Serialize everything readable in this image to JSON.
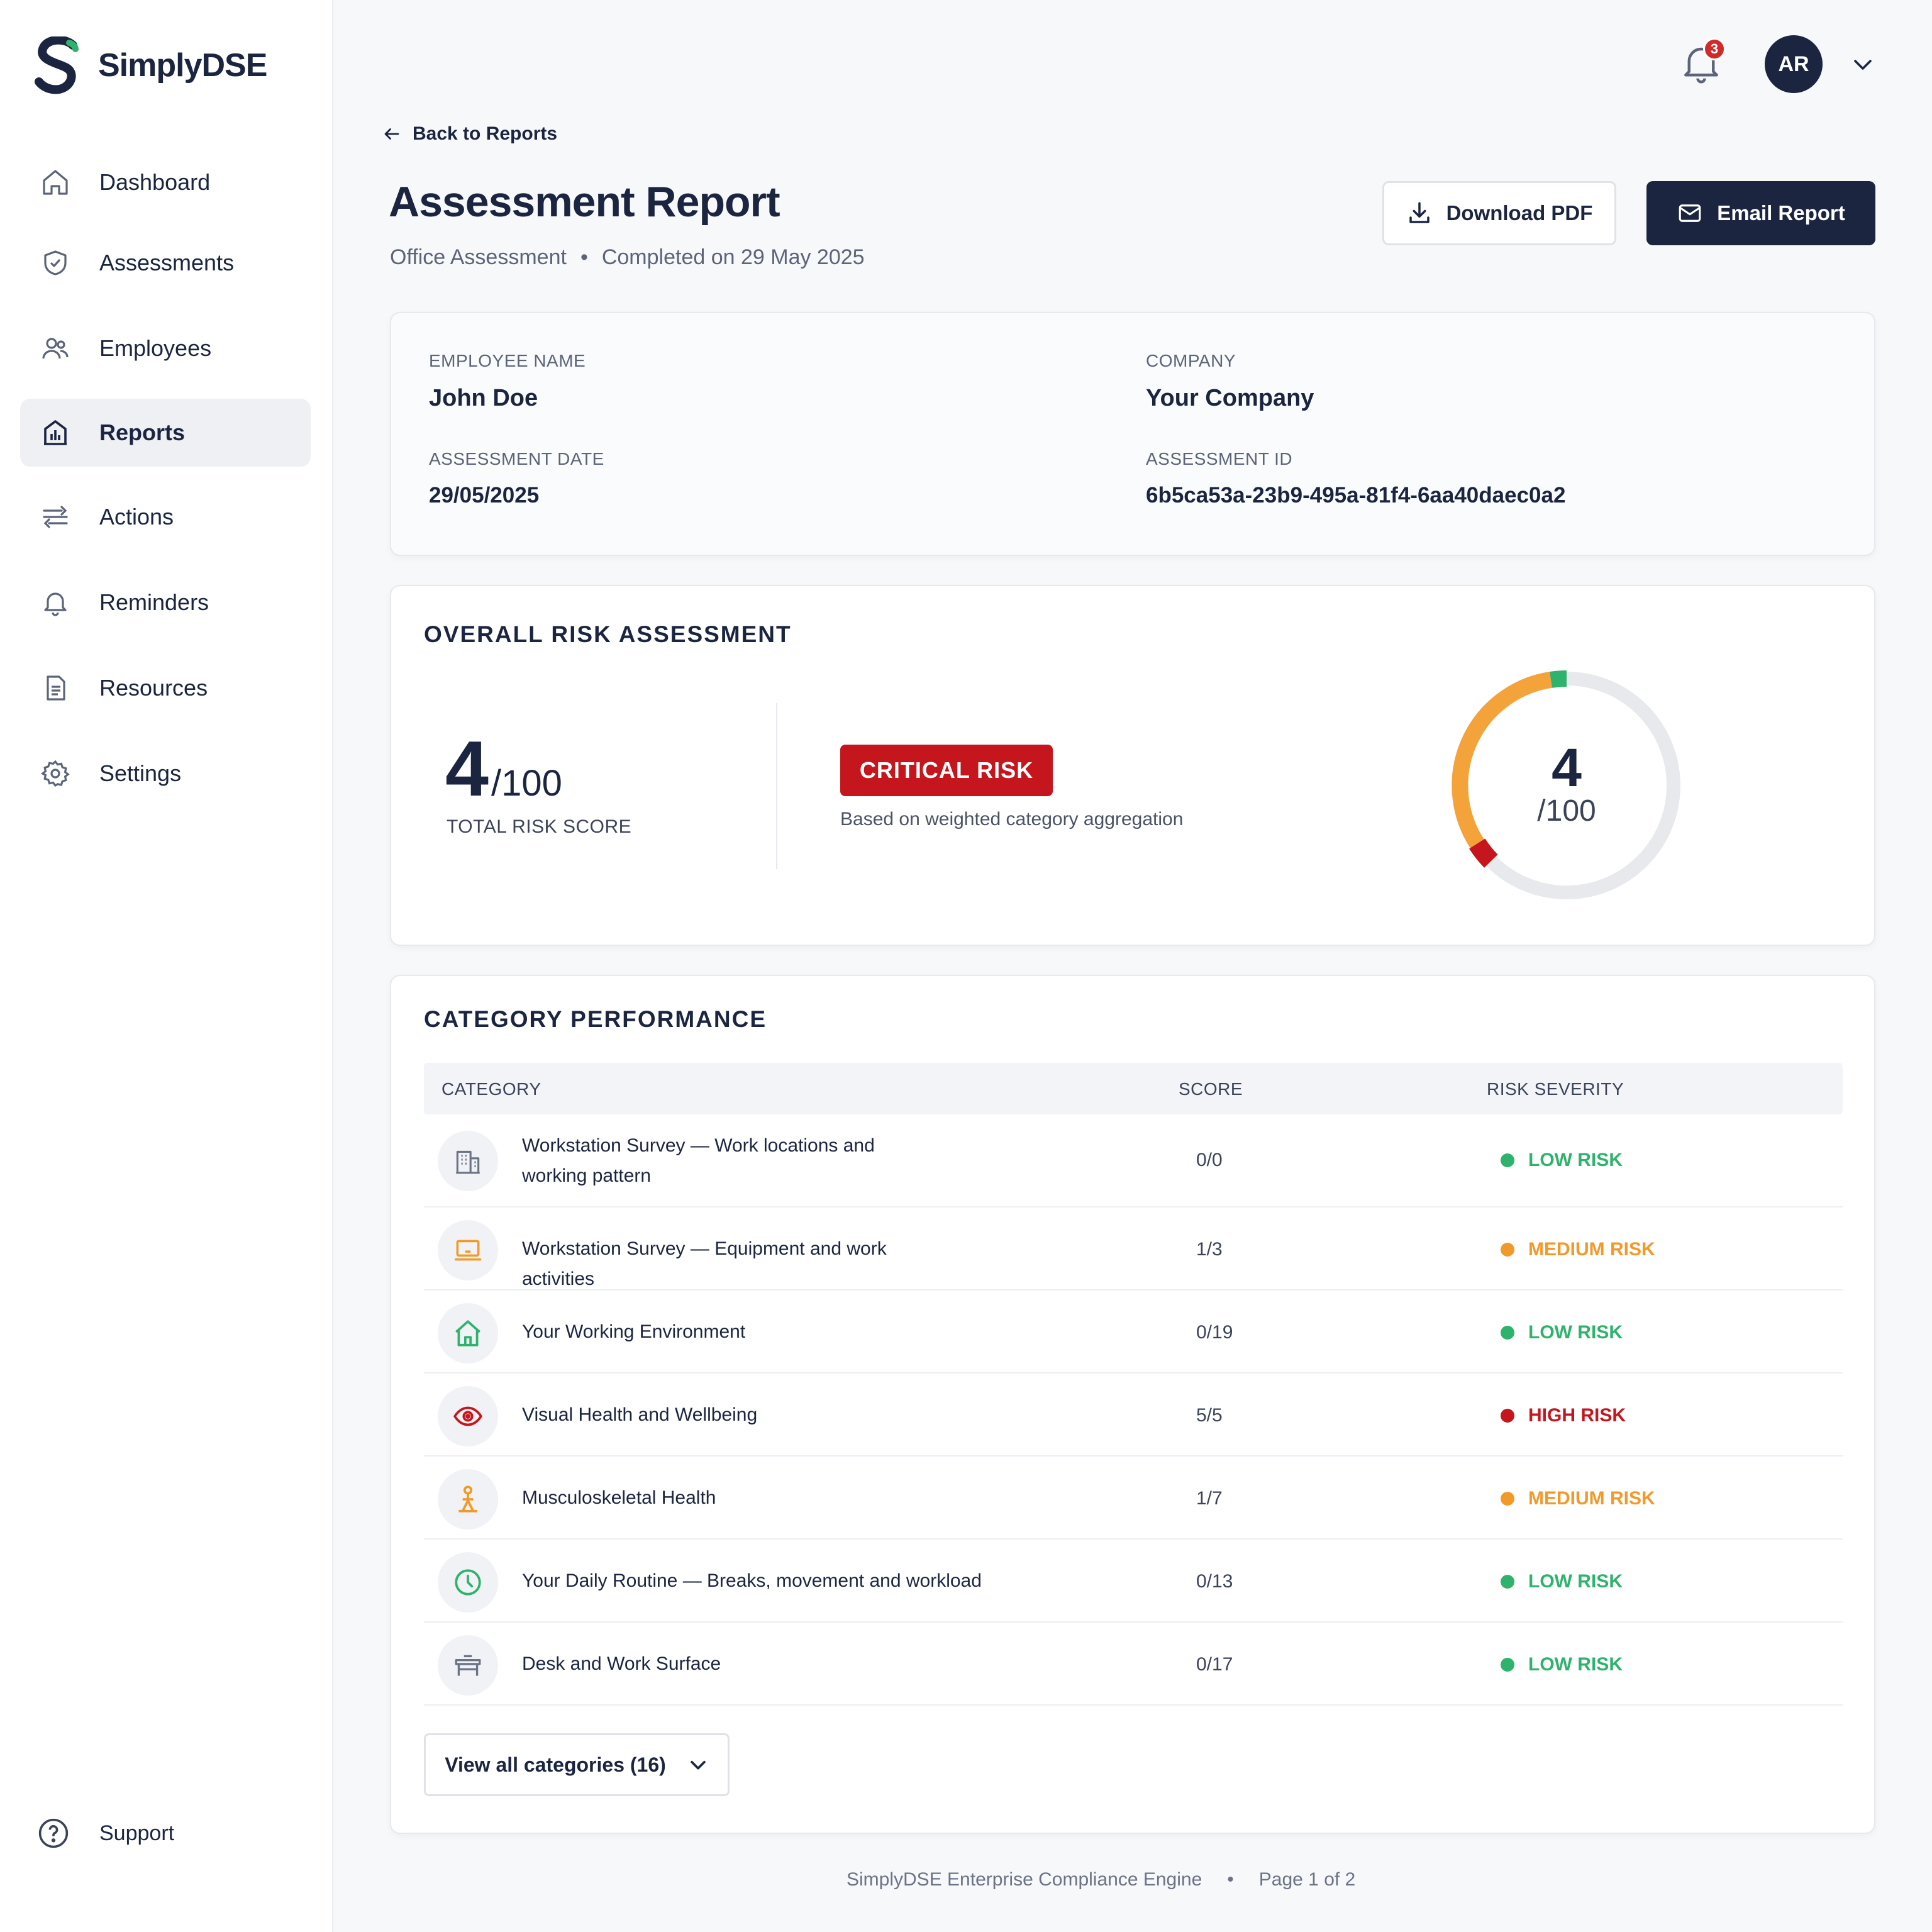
{
  "app": {
    "name": "SimplyDSE"
  },
  "sidebar": {
    "items": [
      {
        "label": "Dashboard",
        "icon": "home-icon",
        "active": false
      },
      {
        "label": "Assessments",
        "icon": "shield-check-icon",
        "active": false
      },
      {
        "label": "Employees",
        "icon": "users-icon",
        "active": false
      },
      {
        "label": "Reports",
        "icon": "bar-chart-icon",
        "active": true
      },
      {
        "label": "Actions",
        "icon": "sliders-icon",
        "active": false
      },
      {
        "label": "Reminders",
        "icon": "bell-icon",
        "active": false
      },
      {
        "label": "Resources",
        "icon": "document-icon",
        "active": false
      },
      {
        "label": "Settings",
        "icon": "gear-icon",
        "active": false
      }
    ],
    "support_label": "Support"
  },
  "topbar": {
    "notification_count": "3",
    "avatar_initials": "AR"
  },
  "header": {
    "back_label": "Back to Reports",
    "title": "Assessment Report",
    "assessment_type": "Office Assessment",
    "separator": "•",
    "completed": "Completed on 29 May 2025",
    "download_label": "Download PDF",
    "email_label": "Email Report"
  },
  "info": {
    "employee_name_label": "EMPLOYEE NAME",
    "employee_name": "John Doe",
    "company_label": "COMPANY",
    "company": "Your Company",
    "date_label": "ASSESSMENT DATE",
    "date": "29/05/2025",
    "id_label": "ASSESSMENT ID",
    "id": "6b5ca53a-23b9-495a-81f4-6aa40daec0a2"
  },
  "risk": {
    "section_title": "OVERALL RISK ASSESSMENT",
    "score": "4",
    "score_max": "/100",
    "score_caption": "TOTAL RISK SCORE",
    "badge": "CRITICAL RISK",
    "badge_caption": "Based on weighted category aggregation",
    "gauge_value": 4,
    "gauge_max": 100,
    "colors": {
      "critical": "#c4161c",
      "orange": "#f4a23a",
      "green": "#2fb36c",
      "track": "#e8e9ec"
    }
  },
  "categories": {
    "section_title": "CATEGORY PERFORMANCE",
    "headers": {
      "category": "CATEGORY",
      "score": "SCORE",
      "severity": "RISK SEVERITY"
    },
    "rows": [
      {
        "name": "Workstation Survey — Work locations and working pattern",
        "score": "0/0",
        "risk": "LOW RISK",
        "icon": "building-icon"
      },
      {
        "name": "Workstation Survey — Equipment and work activities",
        "score": "1/3",
        "risk": "MEDIUM RISK",
        "icon": "laptop-icon"
      },
      {
        "name": "Your Working Environment",
        "score": "0/19",
        "risk": "LOW RISK",
        "icon": "home-icon"
      },
      {
        "name": "Visual Health and Wellbeing",
        "score": "5/5",
        "risk": "HIGH RISK",
        "icon": "eye-icon"
      },
      {
        "name": "Musculoskeletal Health",
        "score": "1/7",
        "risk": "MEDIUM RISK",
        "icon": "person-posture-icon"
      },
      {
        "name": "Your Daily Routine — Breaks, movement and workload",
        "score": "0/13",
        "risk": "LOW RISK",
        "icon": "clock-icon"
      },
      {
        "name": "Desk and Work Surface",
        "score": "0/17",
        "risk": "LOW RISK",
        "icon": "desk-icon"
      }
    ],
    "risk_colors": {
      "LOW RISK": "#2fb36c",
      "MEDIUM RISK": "#f19a2b",
      "HIGH RISK": "#c4161c"
    },
    "view_all_label": "View all categories (16)"
  },
  "footer": {
    "engine": "SimplyDSE Enterprise Compliance Engine",
    "separator": "•",
    "page": "Page 1 of 2"
  }
}
